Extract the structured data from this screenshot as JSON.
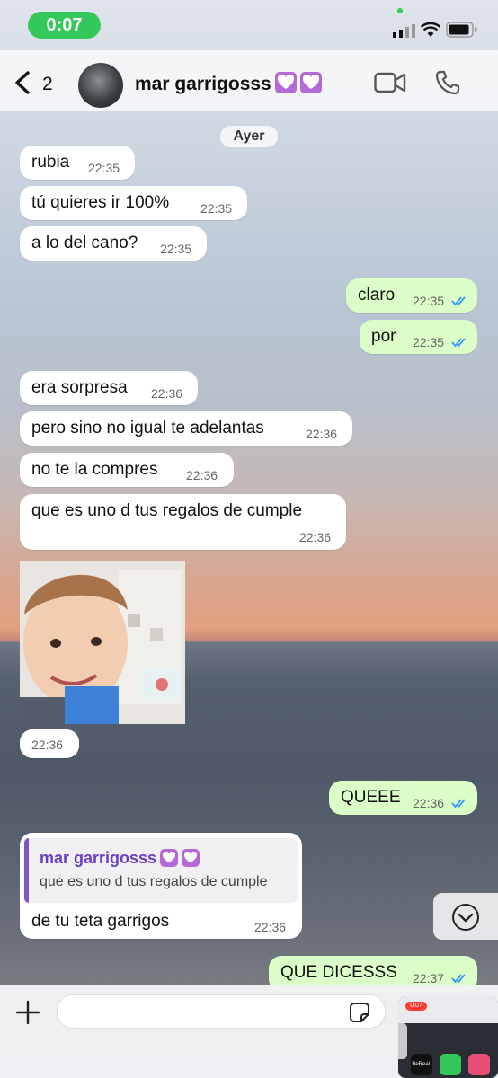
{
  "status_bar": {
    "time": "0:07"
  },
  "header": {
    "back_count": "2",
    "contact_name": "mar garrigosss"
  },
  "chat": {
    "date_label": "Ayer",
    "messages": [
      {
        "text": "rubia",
        "time": "22:35"
      },
      {
        "text": "tú quieres ir 100%",
        "time": "22:35"
      },
      {
        "text": "a lo del cano?",
        "time": "22:35"
      },
      {
        "text": "claro",
        "time": "22:35"
      },
      {
        "text": "por",
        "time": "22:35"
      },
      {
        "text": "era sorpresa",
        "time": "22:36"
      },
      {
        "text": "pero sino no igual te adelantas",
        "time": "22:36"
      },
      {
        "text": "no te la compres",
        "time": "22:36"
      },
      {
        "text": "que es uno d tus regalos de cumple",
        "time": "22:36"
      },
      {
        "text": "",
        "time": "22:36"
      },
      {
        "text": "QUEEE",
        "time": "22:36"
      },
      {
        "text": "de tu teta garrigos",
        "time": "22:36",
        "reply_to": {
          "name": "mar garrigosss",
          "text": "que es uno d tus regalos de cumple"
        }
      },
      {
        "text": "QUE DICESSS",
        "time": "22:37"
      }
    ]
  },
  "pip": {
    "time": "0:07",
    "app_label": "BeReal."
  },
  "colors": {
    "incoming": "#ffffff",
    "outgoing": "#dbfdc8",
    "accent": "#34c759",
    "read_ticks": "#3497f9"
  },
  "icons": [
    "chevron-left-icon",
    "video-icon",
    "phone-icon",
    "plus-icon",
    "sticker-icon",
    "chevron-down-icon",
    "purple-heart-icon",
    "double-check-icon"
  ]
}
